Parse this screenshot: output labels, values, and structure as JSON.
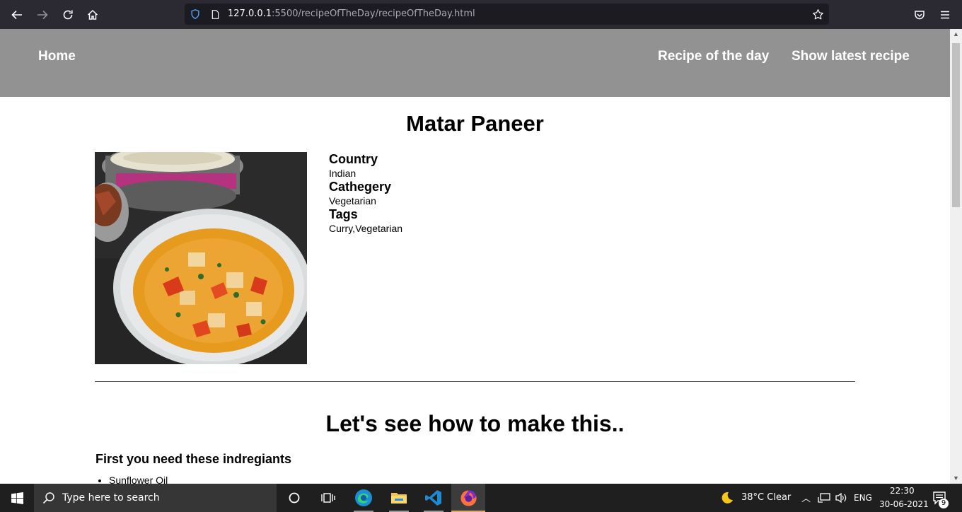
{
  "browser": {
    "url_host": "127.0.0.1",
    "url_path": ":5500/recipeOfTheDay/recipeOfTheDay.html"
  },
  "site_nav": {
    "home": "Home",
    "recipe_of_day": "Recipe of the day",
    "latest_recipe": "Show latest recipe"
  },
  "recipe": {
    "title": "Matar Paneer",
    "country_label": "Country",
    "country_value": "Indian",
    "category_label": "Cathegery",
    "category_value": "Vegetarian",
    "tags_label": "Tags",
    "tags_value": "Curry,Vegetarian"
  },
  "instructions": {
    "heading": "Let's see how to make this..",
    "ingredients_heading": "First you need these indregiants",
    "ingredients": [
      "Sunflower Oil"
    ]
  },
  "taskbar": {
    "search_placeholder": "Type here to search",
    "weather": "38°C  Clear",
    "language": "ENG",
    "time": "22:30",
    "date": "30-06-2021",
    "notification_count": "9"
  }
}
